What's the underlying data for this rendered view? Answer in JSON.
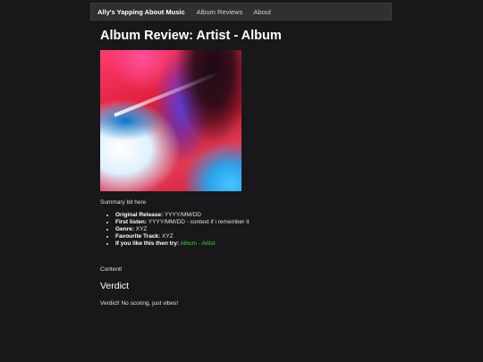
{
  "nav": {
    "brand": "Ally's Yapping About Music",
    "links": [
      "Album Reviews",
      "About"
    ]
  },
  "page": {
    "title": "Album Review: Artist - Album",
    "summary": "Summary bit here",
    "facts": [
      {
        "label": "Original Release:",
        "value": "YYYY/MM/DD"
      },
      {
        "label": "First listen:",
        "value": "YYYY/MM/DD - context if i remember it"
      },
      {
        "label": "Genre:",
        "value": "XYZ"
      },
      {
        "label": "Favourite Track:",
        "value": "XYZ"
      },
      {
        "label": "If you like this then try:",
        "value": "",
        "link": "Album - Artist"
      }
    ],
    "content": "Content!",
    "verdict_heading": "Verdict",
    "verdict_text": "Verdict! No scoring, just vibes!"
  },
  "colors": {
    "background": "#18181a",
    "navbar": "#303032",
    "link_accent": "#38d938"
  },
  "icons": {
    "cover": "album-cover-image"
  }
}
